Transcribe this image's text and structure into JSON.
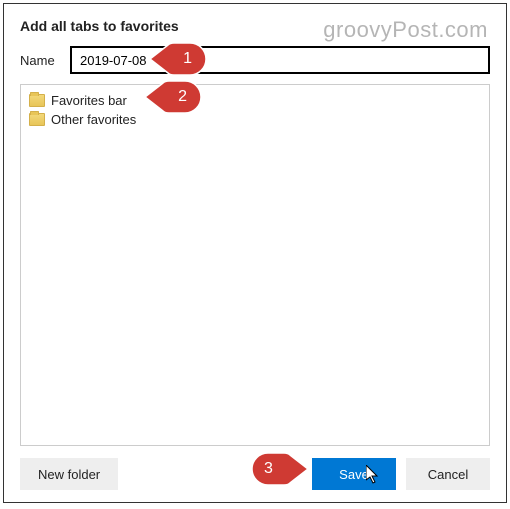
{
  "dialog": {
    "title": "Add all tabs to favorites",
    "name_label": "Name",
    "name_value": "2019-07-08"
  },
  "folders": [
    {
      "label": "Favorites bar"
    },
    {
      "label": "Other favorites"
    }
  ],
  "buttons": {
    "new_folder": "New folder",
    "save": "Save",
    "cancel": "Cancel"
  },
  "callouts": {
    "c1": "1",
    "c2": "2",
    "c3": "3"
  },
  "watermark": "groovyPost.com"
}
